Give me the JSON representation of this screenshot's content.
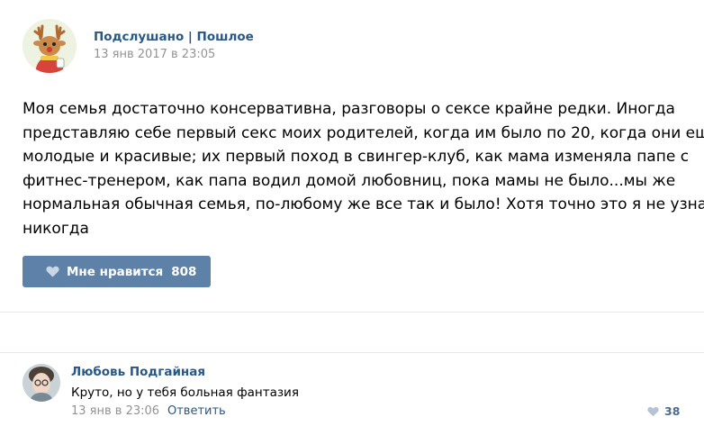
{
  "post": {
    "author": "Подслушано | Пошлое",
    "date": "13 янв 2017 в 23:05",
    "text_lines": [
      "Моя семья достаточно консервативна, разговоры о сексе крайне редки. Иногда",
      "представляю себе первый секс моих родителей, когда им было по 20, когда они ещё",
      "молодые и красивые; их первый поход в свингер-клуб, как мама изменяла папе с",
      "фитнес-тренером, как папа водил домой любовниц, пока мамы не было...мы же",
      "нормальная обычная семья, по-любому же все так и было! Хотя точно это я не узнаю",
      "никогда"
    ],
    "like_label": "Мне нравится",
    "like_count": "808",
    "avatar_icon": "deer-avatar-icon"
  },
  "comment": {
    "author": "Любовь Подгайная",
    "text": "Круто, но у тебя больная фантазия",
    "date": "13 янв в 23:06",
    "reply_label": "Ответить",
    "like_count": "38",
    "avatar_icon": "user-photo-avatar"
  },
  "colors": {
    "link": "#2a5885",
    "meta": "#939393",
    "like_button_bg": "#5e81a8",
    "divider": "#e7e8ec",
    "comment_like": "#4a6c91"
  }
}
